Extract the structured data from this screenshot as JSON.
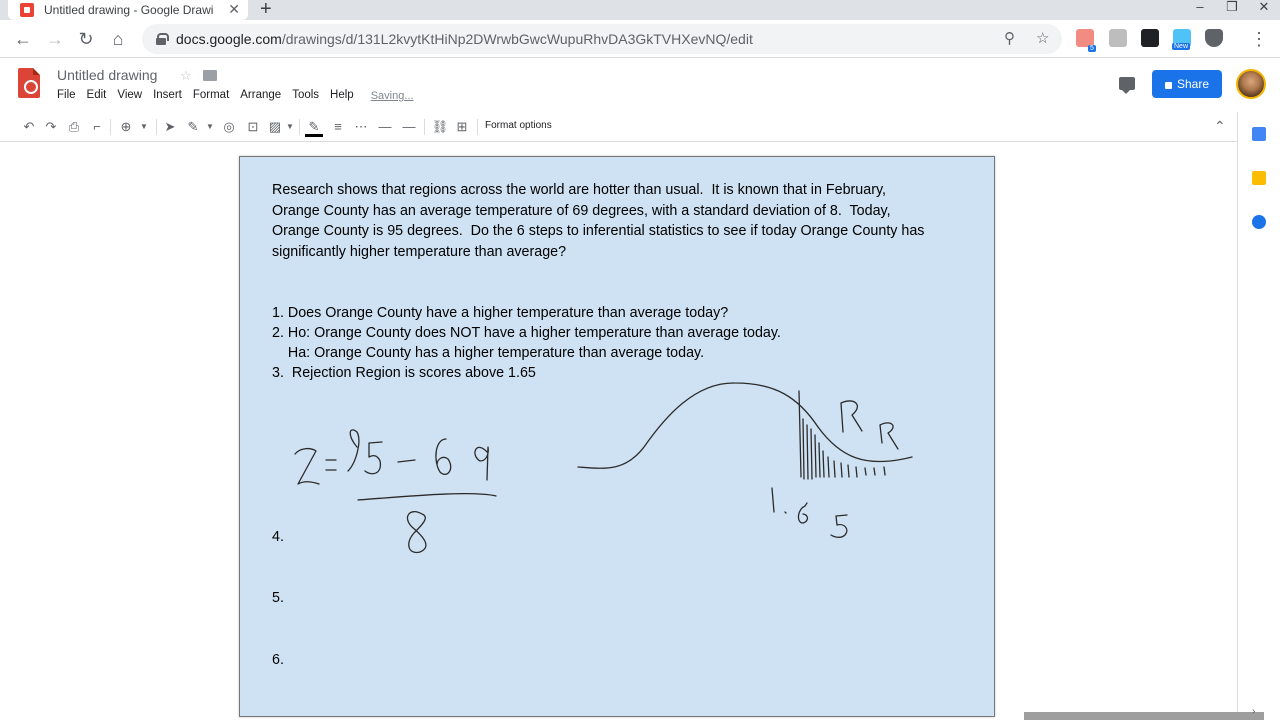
{
  "browser": {
    "tab_title": "Untitled drawing - Google Drawi",
    "url_host": "docs.google.com",
    "url_path": "/drawings/d/131L2kvytKtHiNp2DWrwbGwcWupuRhvDA3GkTVHXevNQ/edit",
    "extension_badge": "5",
    "extension_new": "New"
  },
  "app": {
    "doc_title": "Untitled drawing",
    "menu": [
      "File",
      "Edit",
      "View",
      "Insert",
      "Format",
      "Arrange",
      "Tools",
      "Help"
    ],
    "save_status": "Saving...",
    "share_label": "Share",
    "format_options": "Format options"
  },
  "slide": {
    "intro": [
      "Research shows that regions across the world are hotter than usual.  It is known that in February,",
      "Orange County has an average temperature of 69 degrees, with a standard deviation of 8.  Today,",
      "Orange County is 95 degrees.  Do the 6 steps to inferential statistics to see if today Orange County has",
      "significantly higher temperature than average?"
    ],
    "steps": [
      "1. Does Orange County have a higher temperature than average today?",
      "2. Ho: Orange County does NOT have a higher temperature than average today.",
      "    Ha: Orange County has a higher temperature than average today.",
      "3.  Rejection Region is scores above 1.65"
    ],
    "step4": "4.",
    "step5": "5.",
    "step6": "6."
  },
  "handwriting": {
    "formula": "z = (95 - 69) / 8",
    "rejection_label": "RR",
    "critical_value": "1.65"
  },
  "colors": {
    "slide_bg": "#cfe2f3",
    "share_blue": "#1a73e8",
    "drawings_red": "#db4437"
  }
}
